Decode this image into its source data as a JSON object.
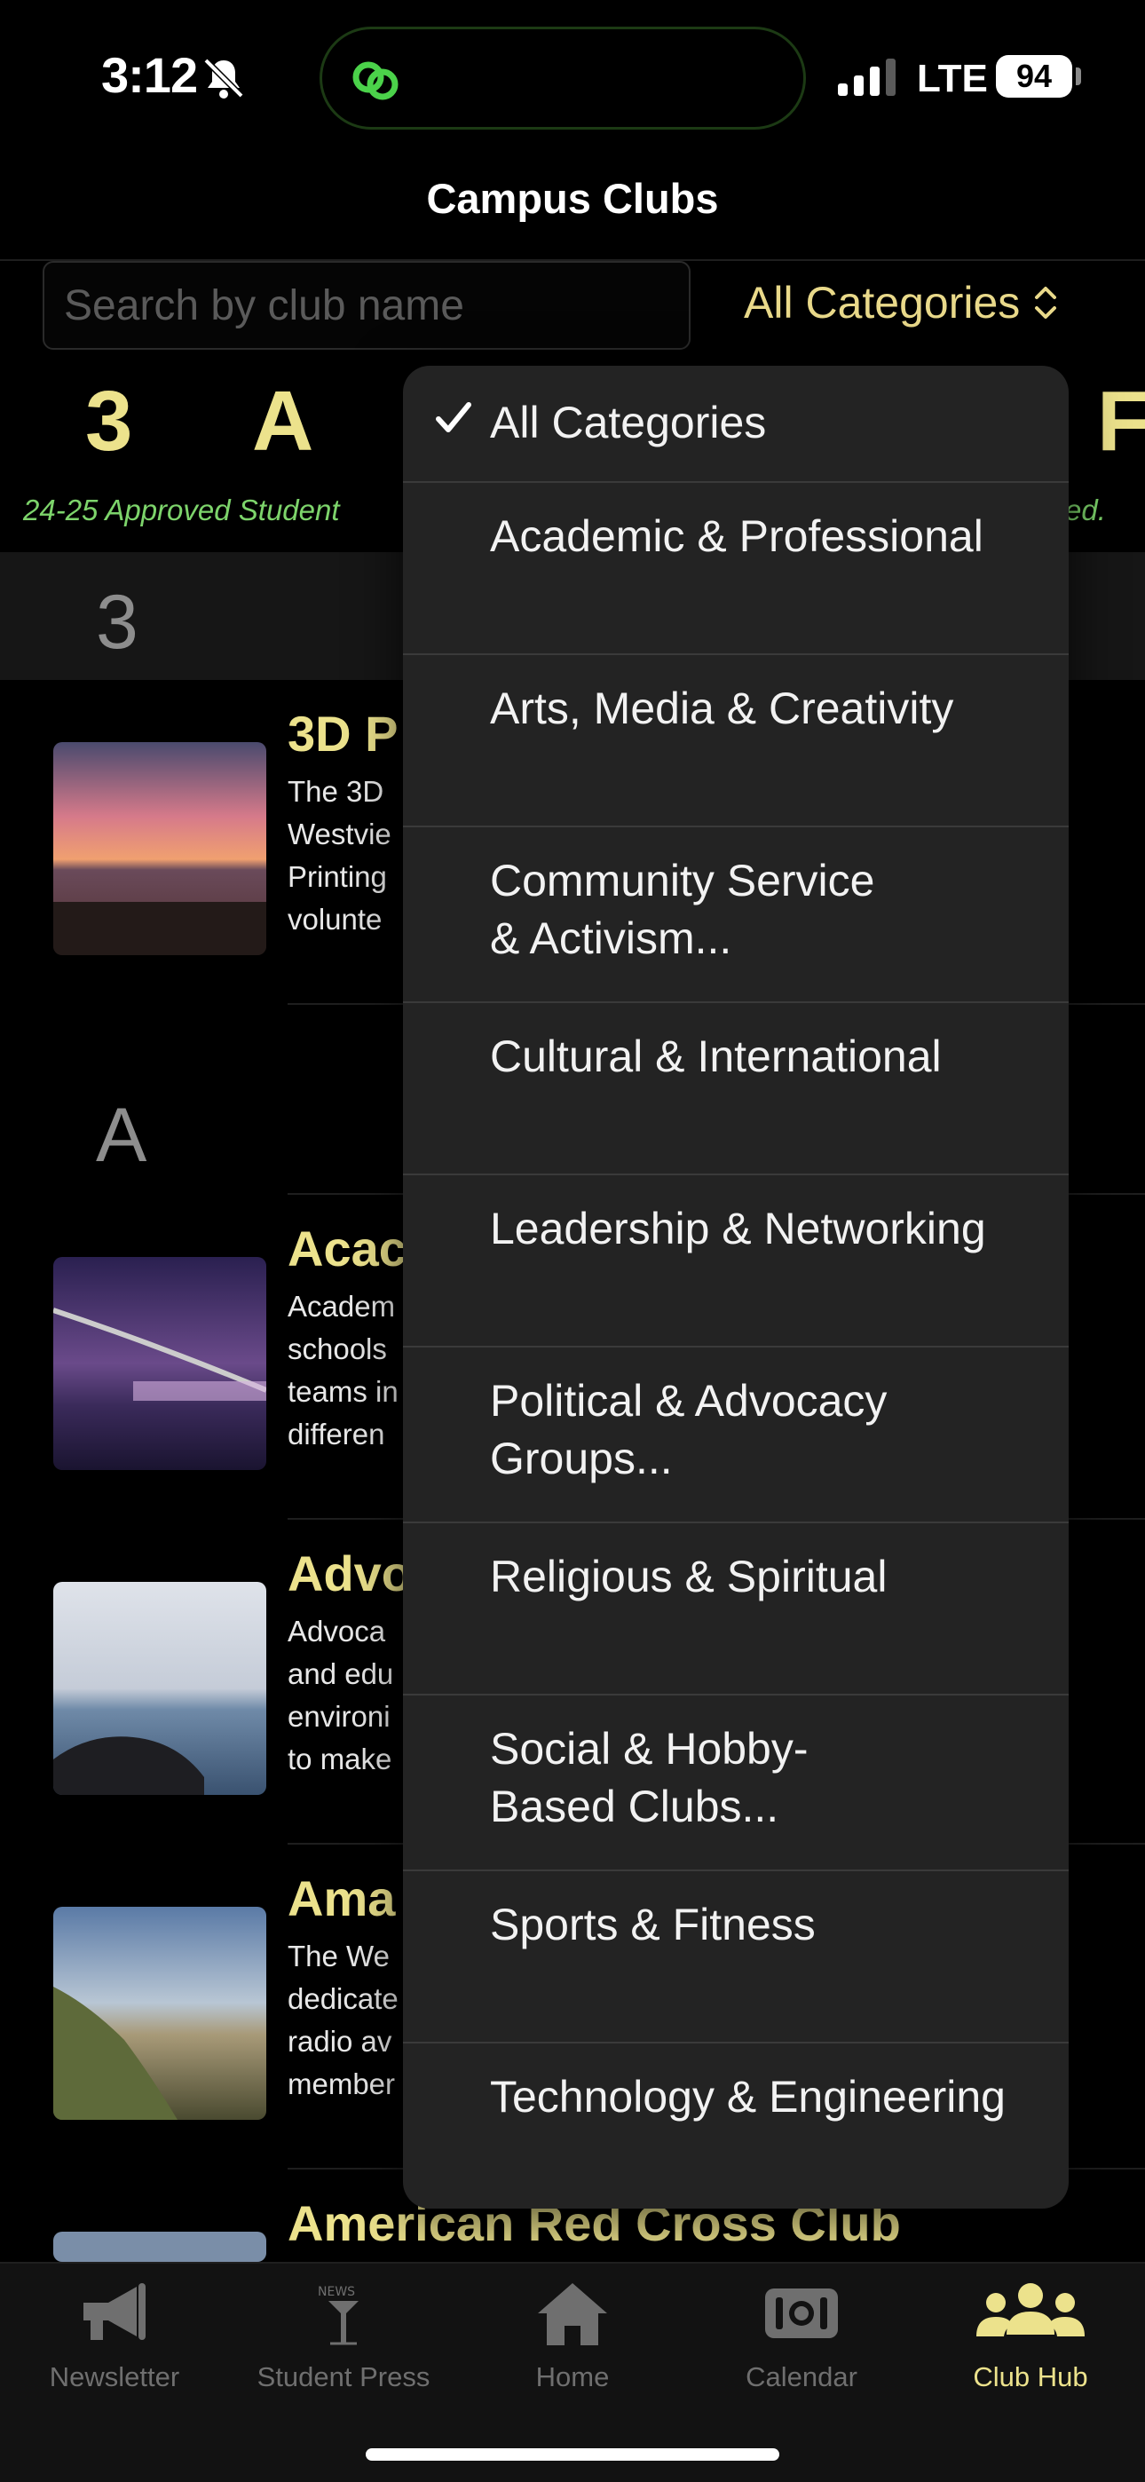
{
  "status_bar": {
    "time": "3:12",
    "network": "LTE",
    "battery": "94"
  },
  "nav": {
    "title": "Campus Clubs"
  },
  "search": {
    "placeholder": "Search by club name",
    "value": ""
  },
  "category_select": {
    "selected": "All Categories"
  },
  "alphabet_strip": {
    "letters": [
      "3",
      "A"
    ],
    "right_letter": "F"
  },
  "approved_note": {
    "left": "24-25 Approved Student",
    "right": "ed."
  },
  "sections": [
    {
      "letter": "3"
    },
    {
      "letter": "A"
    }
  ],
  "clubs": [
    {
      "name": "3D P",
      "description": "The 3D\nWestvie\nPrinting\nvolunte"
    },
    {
      "name": "Acac",
      "description": "Academ\nschools\nteams in\ndifferen"
    },
    {
      "name": "Advo",
      "description": "Advoca\nand edu\nenvironi\nto make"
    },
    {
      "name": "Ama",
      "description": "The We\ndedicate\nradio av\nmember"
    },
    {
      "name": "American Red Cross Club",
      "description": ""
    }
  ],
  "dropdown": {
    "items": [
      {
        "label": "All Categories",
        "checked": true
      },
      {
        "label": "Academic & Professional",
        "checked": false
      },
      {
        "label": "Arts, Media & Creativity",
        "checked": false
      },
      {
        "label": "Community Service\n& Activism...",
        "checked": false
      },
      {
        "label": "Cultural & International",
        "checked": false
      },
      {
        "label": "Leadership & Networking",
        "checked": false
      },
      {
        "label": "Political & Advocacy\nGroups...",
        "checked": false
      },
      {
        "label": "Religious & Spiritual",
        "checked": false
      },
      {
        "label": "Social & Hobby-\nBased Clubs...",
        "checked": false
      },
      {
        "label": "Sports & Fitness",
        "checked": false
      },
      {
        "label": "Technology & Engineering",
        "checked": false
      }
    ]
  },
  "tab_bar": {
    "tabs": [
      {
        "label": "Newsletter",
        "icon": "megaphone-icon",
        "active": false
      },
      {
        "label": "Student Press",
        "icon": "press-logo-icon",
        "active": false
      },
      {
        "label": "Home",
        "icon": "house-icon",
        "active": false
      },
      {
        "label": "Calendar",
        "icon": "ticket-icon",
        "active": false
      },
      {
        "label": "Club Hub",
        "icon": "people-icon",
        "active": true
      }
    ]
  },
  "colors": {
    "accent": "#ece28c",
    "note_green": "#7dd46b",
    "menu_bg": "#232323",
    "background": "#000000"
  }
}
